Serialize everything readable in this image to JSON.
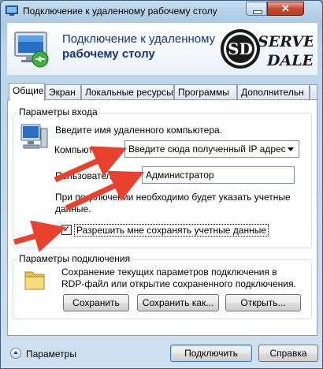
{
  "window": {
    "title": "Подключение к удаленному рабочему столу",
    "close_glyph": "✕"
  },
  "header": {
    "line1": "Подключение к удаленному",
    "line2": "рабочему столу",
    "logo_text": "SD Server Dale"
  },
  "tabs": [
    {
      "label": "Общие"
    },
    {
      "label": "Экран"
    },
    {
      "label": "Локальные ресурсы"
    },
    {
      "label": "Программы"
    },
    {
      "label": "Дополнительн"
    }
  ],
  "login_group": {
    "title": "Параметры входа",
    "prompt": "Введите имя удаленного компьютера.",
    "computer_label": "Компьютер:",
    "computer_value": "Введите сюда полученный IP адрес",
    "user_label": "Пользователь:",
    "user_value": "Администратор",
    "info_line1": "При подключении необходимо будет указать учетные",
    "info_line2": "данные.",
    "save_creds_label": "Разрешить мне сохранять учетные данные",
    "save_creds_checked": true
  },
  "conn_group": {
    "title": "Параметры подключения",
    "desc_line1": "Сохранение текущих параметров подключения в",
    "desc_line2": "RDP-файл или открытие сохраненного подключения.",
    "save_button": "Сохранить",
    "save_as_button": "Сохранить как...",
    "open_button": "Открыть..."
  },
  "footer": {
    "params_label": "Параметры",
    "connect_button": "Подключить",
    "help_button": "Справка"
  },
  "colors": {
    "arrow": "#e8412d",
    "header_text": "#14367a"
  }
}
